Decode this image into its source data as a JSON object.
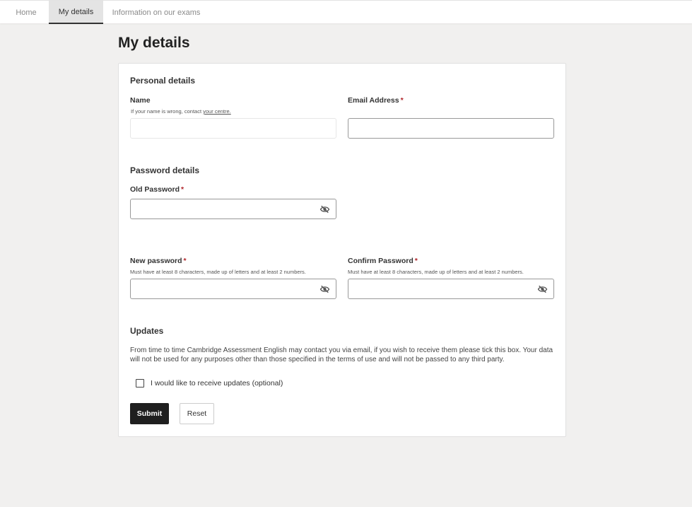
{
  "nav": {
    "tabs": [
      {
        "label": "Home"
      },
      {
        "label": "My details",
        "active": true
      },
      {
        "label": "Information on our exams"
      }
    ]
  },
  "page": {
    "title": "My details"
  },
  "personal": {
    "title": "Personal details",
    "name_label": "Name",
    "name_hint": "If your name is wrong, contact",
    "name_hint_link": "your centre.",
    "name_value": "",
    "email_label": "Email Address",
    "email_value": ""
  },
  "password": {
    "title": "Password details",
    "old_label": "Old Password",
    "new_label": "New password",
    "new_hint": "Must have at least 8 characters, made up of letters and at least 2 numbers.",
    "confirm_label": "Confirm Password",
    "confirm_hint": "Must have at least 8 characters, made up of letters and at least 2 numbers.",
    "toggle_icon": "eye-slash-icon"
  },
  "updates": {
    "title": "Updates",
    "text": "From time to time Cambridge Assessment English may contact you via email, if you wish to receive them please tick this box. Your data will not be used for any purposes other than those specified in the terms of use and will not be passed to any third party.",
    "checkbox_label": "I would like to receive updates (optional)",
    "checked": false
  },
  "actions": {
    "submit": "Submit",
    "reset": "Reset"
  },
  "required_marker": "*",
  "colors": {
    "required": "#b0252a",
    "submit_bg": "#1f1f1f",
    "page_bg": "#f1f0ef"
  }
}
